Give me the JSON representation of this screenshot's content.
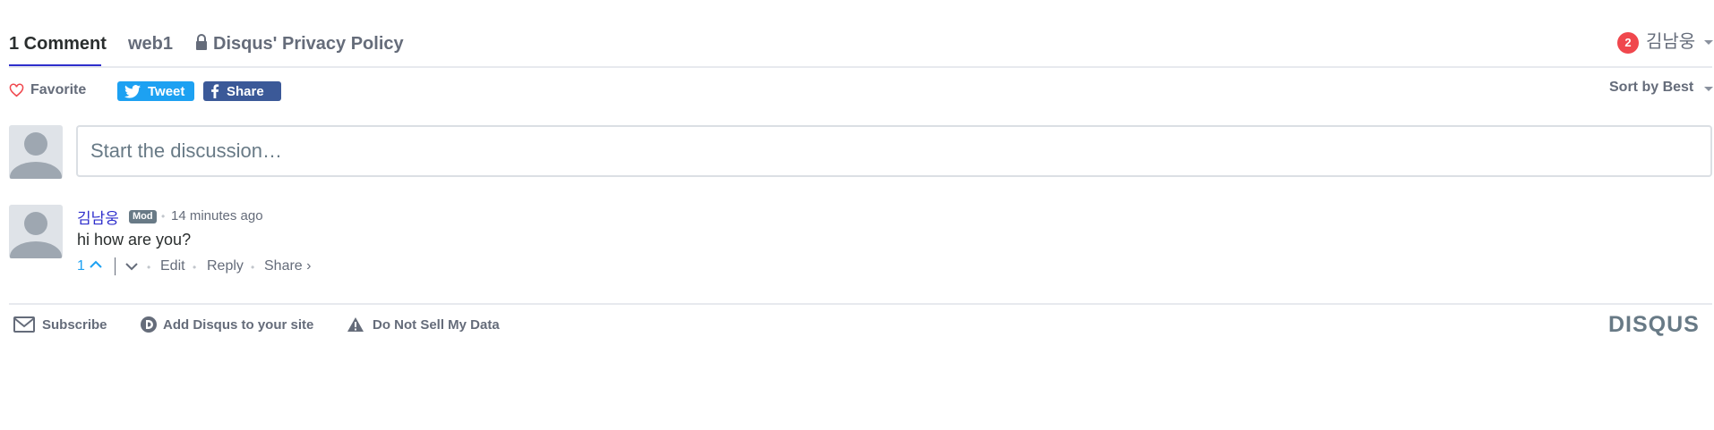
{
  "nav": {
    "comments_tab": "1 Comment",
    "site_tab": "web1",
    "privacy_tab": "Disqus' Privacy Policy",
    "notification_count": "2",
    "username": "김남웅"
  },
  "actions": {
    "favorite_label": "Favorite",
    "tweet_label": "Tweet",
    "share_label": "Share",
    "sort_label": "Sort by Best"
  },
  "composer": {
    "placeholder": "Start the discussion…"
  },
  "comments": [
    {
      "author": "김남웅",
      "badge": "Mod",
      "time": "14 minutes ago",
      "text": "hi how are you?",
      "upvotes": "1",
      "edit_label": "Edit",
      "reply_label": "Reply",
      "share_label": "Share ›"
    }
  ],
  "footer": {
    "subscribe_label": "Subscribe",
    "add_disqus_label": "Add Disqus to your site",
    "do_not_sell_label": "Do Not Sell My Data",
    "logo_text": "DISQUS"
  },
  "colors": {
    "accent": "#2e2ecc",
    "tweet": "#1da1f2",
    "facebook": "#3b5998",
    "notification": "#f0474d",
    "favorite_heart": "#f0474d",
    "muted_text": "#656c7a"
  },
  "icons": [
    "lock-icon",
    "heart-icon",
    "twitter-bird-icon",
    "facebook-f-icon",
    "avatar-placeholder-icon",
    "chevron-up-icon",
    "chevron-down-icon",
    "envelope-icon",
    "disqus-d-icon",
    "warning-icon",
    "caret-down-icon"
  ]
}
